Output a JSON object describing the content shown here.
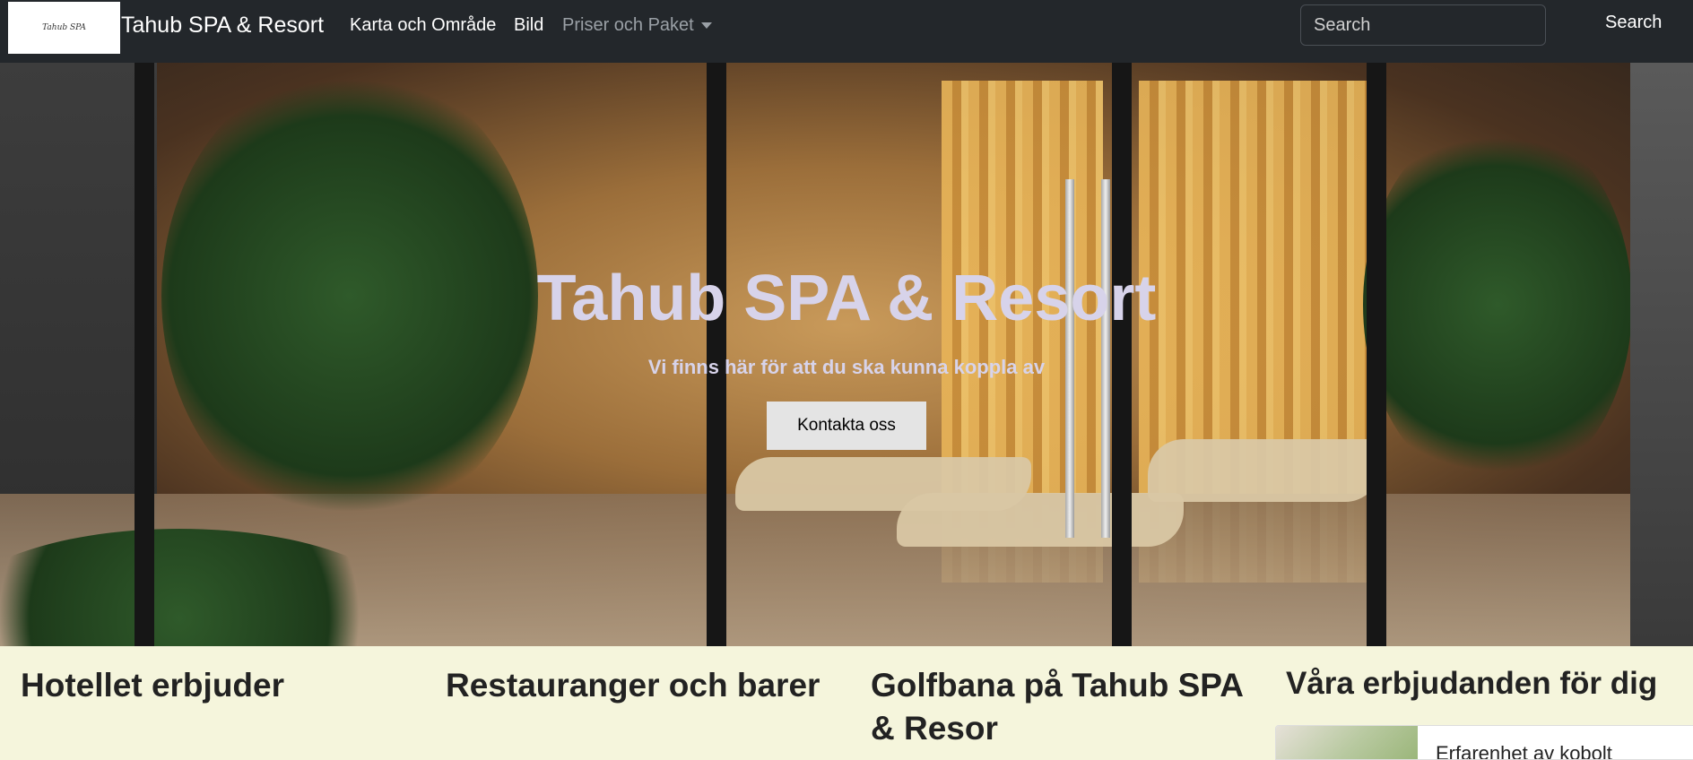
{
  "navbar": {
    "logo_text": "Tahub SPA",
    "brand": "Tahub SPA & Resort",
    "links": [
      "Karta och Område",
      "Bild"
    ],
    "dropdown_label": "Priser och Paket",
    "search_placeholder": "Search",
    "search_button": "Search"
  },
  "hero": {
    "title": "Tahub SPA & Resort",
    "subtitle": "Vi finns här för att du ska kunna koppla av",
    "button": "Kontakta oss"
  },
  "sections": {
    "col1_title": "Hotellet erbjuder",
    "col2_title": "Restauranger och barer",
    "col3_title": "Golfbana på Tahub SPA & Resor",
    "col4_title": "Våra erbjudanden för dig",
    "offer_text": "Erfarenhet av kobolt"
  },
  "icons": {
    "dropdown": "caret-down-icon"
  }
}
